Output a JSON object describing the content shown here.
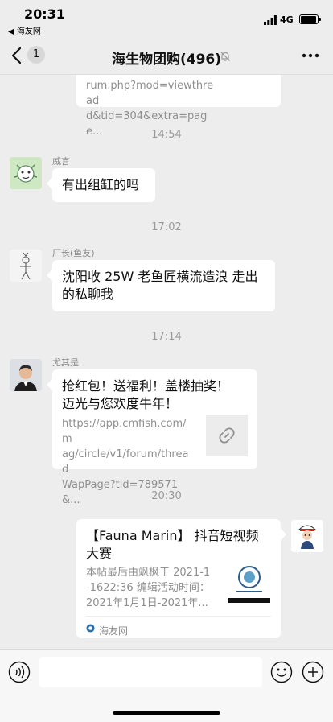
{
  "status_bar": {
    "time": "20:31",
    "back_app": "◀ 海友网",
    "network": "4G"
  },
  "nav": {
    "unread_count": "1",
    "title": "海生物团购(496)"
  },
  "chat": {
    "partial_link": {
      "desc_line1": "rum.php?mod=viewthread",
      "desc_line2": "d&tid=304&extra=page..."
    },
    "messages": [
      {
        "time": "14:54",
        "sender": "威言",
        "text": "有出组缸的吗"
      },
      {
        "time": "17:02",
        "sender": "厂长(鱼友)",
        "text_line1": "沈阳收 25W 老鱼匠横流造浪 走出",
        "text_line2": "的私聊我"
      },
      {
        "time": "17:14",
        "sender": "尤其是",
        "link": {
          "title_line1": "抢红包！送福利！盖楼抽奖！",
          "title_line2": "迈光与您欢度牛年！",
          "desc_line1": "https://app.cmfish.com/m",
          "desc_line2": "ag/circle/v1/forum/thread",
          "desc_line3": "WapPage?tid=789571&..."
        }
      },
      {
        "time": "20:30",
        "link": {
          "title_line1": "【Fauna Marin】 抖音短视频",
          "title_line2": "大赛",
          "desc_line1": "本帖最后由飒枫于 2021-1",
          "desc_line2": "-1622:36 编辑活动时间：",
          "desc_line3": "2021年1月1日-2021年...",
          "source": "海友网"
        }
      }
    ]
  },
  "icons": [
    "back-arrow-icon",
    "mute-bell-icon",
    "more-icon",
    "link-icon",
    "voice-icon",
    "emoji-icon",
    "plus-icon",
    "signal-icon",
    "battery-icon"
  ],
  "colors": {
    "background": "#ededed",
    "bubble": "#ffffff",
    "muted_text": "#8f8f8f"
  }
}
